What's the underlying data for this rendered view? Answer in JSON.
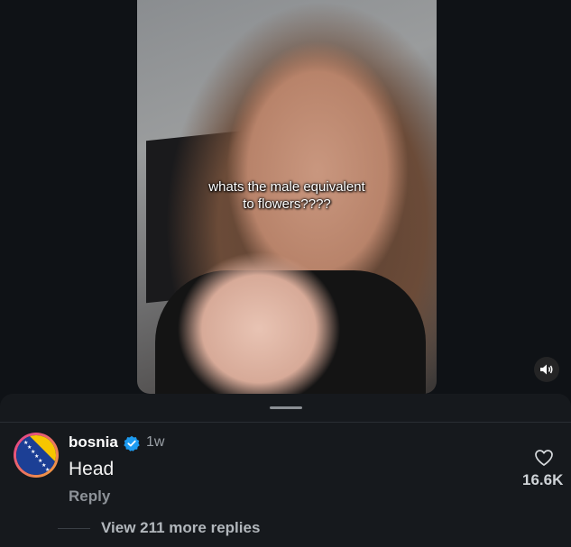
{
  "video": {
    "caption_line1": "whats the male equivalent",
    "caption_line2": "to flowers????"
  },
  "comment": {
    "username": "bosnia",
    "time": "1w",
    "text": "Head",
    "reply_label": "Reply",
    "like_count": "16.6K",
    "view_replies_label": "View 211 more replies",
    "verified": true
  },
  "colors": {
    "verified_blue": "#1d9bf0",
    "bosnia_blue": "#1c3f95",
    "bosnia_yellow": "#f7c600",
    "avatar_ring": "#e43b8f"
  },
  "icons": {
    "sound": "speaker-icon",
    "like": "heart-icon",
    "verified": "verified-badge-icon"
  }
}
